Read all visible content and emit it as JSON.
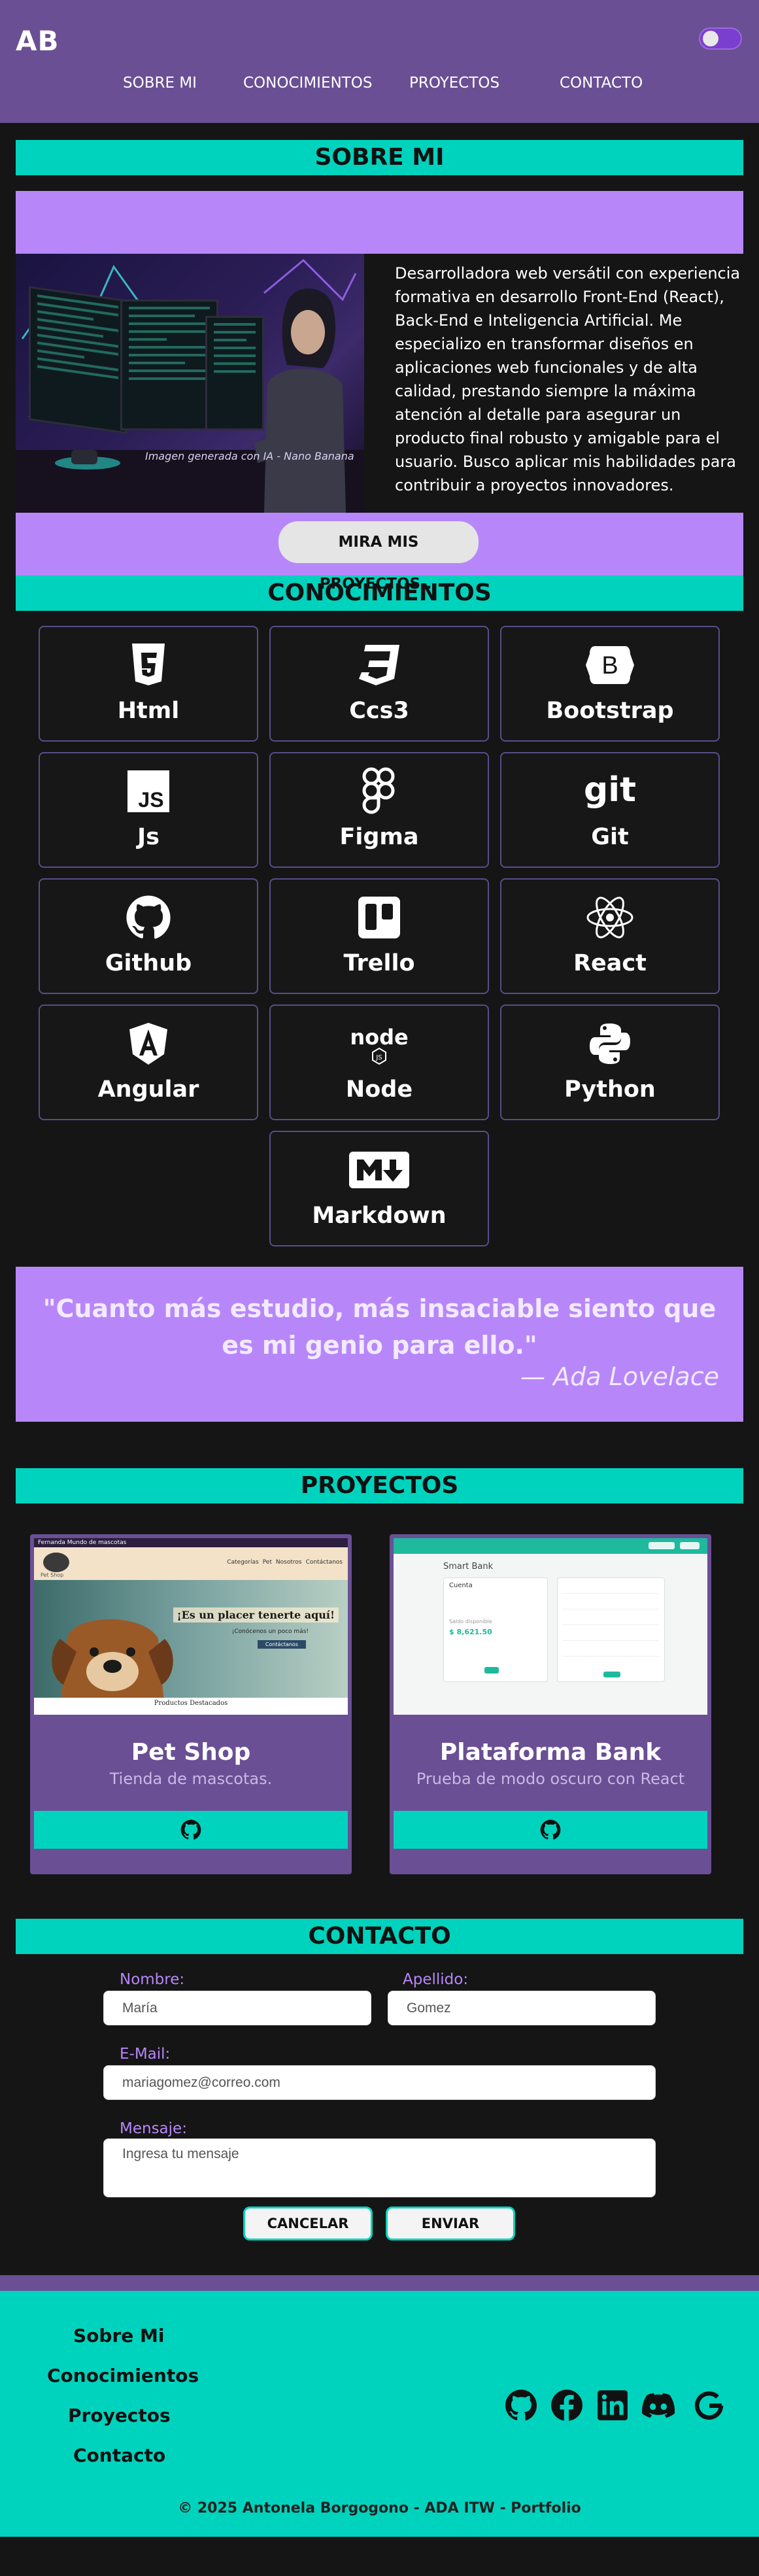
{
  "header": {
    "logo": "AB",
    "nav": [
      "SOBRE MI",
      "CONOCIMIENTOS",
      "PROYECTOS",
      "CONTACTO"
    ],
    "theme_toggle_icon": "toggle-switch-icon"
  },
  "about": {
    "heading": "SOBRE MI",
    "image_caption": "Imagen generada con IA - Nano Banana",
    "text": "Desarrolladora web versátil con experiencia formativa en desarrollo Front-End (React), Back-End e Inteligencia Artificial. Me especializo en transformar diseños en aplicaciones web funcionales y de alta calidad, prestando siempre la máxima atención al detalle para asegurar un producto final robusto y amigable para el usuario. Busco aplicar mis habilidades para contribuir a proyectos innovadores.",
    "button": "MIRA MIS PROYECTOS..."
  },
  "skills": {
    "heading": "CONOCIMIENTOS",
    "items": [
      {
        "label": "Html",
        "icon": "html5-icon"
      },
      {
        "label": "Ccs3",
        "icon": "css3-icon"
      },
      {
        "label": "Bootstrap",
        "icon": "bootstrap-icon"
      },
      {
        "label": "Js",
        "icon": "javascript-icon"
      },
      {
        "label": "Figma",
        "icon": "figma-icon"
      },
      {
        "label": "Git",
        "icon": "git-icon"
      },
      {
        "label": "Github",
        "icon": "github-icon"
      },
      {
        "label": "Trello",
        "icon": "trello-icon"
      },
      {
        "label": "React",
        "icon": "react-icon"
      },
      {
        "label": "Angular",
        "icon": "angular-icon"
      },
      {
        "label": "Node",
        "icon": "nodejs-icon"
      },
      {
        "label": "Python",
        "icon": "python-icon"
      },
      {
        "label": "Markdown",
        "icon": "markdown-icon"
      }
    ]
  },
  "quote": {
    "text": "\"Cuanto más estudio, más insaciable siento que es mi genio para ello.\"",
    "author": "— Ada Lovelace"
  },
  "projects": {
    "heading": "PROYECTOS",
    "items": [
      {
        "title": "Pet Shop",
        "description": "Tienda de mascotas.",
        "shot_header": "Fernanda Mundo de mascotas",
        "shot_slogan": "¡Es un placer tenerte aquí!",
        "shot_sub": "¡Conócenos un poco más!",
        "shot_button": "Contáctanos",
        "shot_nav": [
          "Categorías",
          "Pet",
          "Nosotros",
          "Contáctanos"
        ],
        "shot_footer": "Productos Destacados",
        "shot_brand": "Pet Shop",
        "github_icon": "github-icon"
      },
      {
        "title": "Plataforma Bank",
        "description": "Prueba de modo oscuro con React",
        "shot_title": "Smart Bank",
        "shot_card": "Cuenta",
        "shot_balance_label": "Saldo disponible",
        "shot_balance": "$ 8,621.50",
        "github_icon": "github-icon"
      }
    ]
  },
  "contact": {
    "heading": "CONTACTO",
    "labels": {
      "name": "Nombre:",
      "lastname": "Apellido:",
      "email": "E-Mail:",
      "message": "Mensaje:"
    },
    "placeholders": {
      "name": "María",
      "lastname": "Gomez",
      "email": "mariagomez@correo.com",
      "message": "Ingresa tu mensaje"
    },
    "buttons": {
      "cancel": "CANCELAR",
      "send": "ENVIAR"
    }
  },
  "footer": {
    "links": [
      "Sobre Mi",
      "Conocimientos",
      "Proyectos",
      "Contacto"
    ],
    "social": [
      "github-icon",
      "facebook-icon",
      "linkedin-icon",
      "discord-icon",
      "google-icon"
    ],
    "copyright": "© 2025 Antonela Borgogono - ADA ITW - Portfolio"
  },
  "colors": {
    "header": "#6a4f94",
    "accent": "#00d3bd",
    "lilac": "#b787fa",
    "background": "#151515"
  }
}
